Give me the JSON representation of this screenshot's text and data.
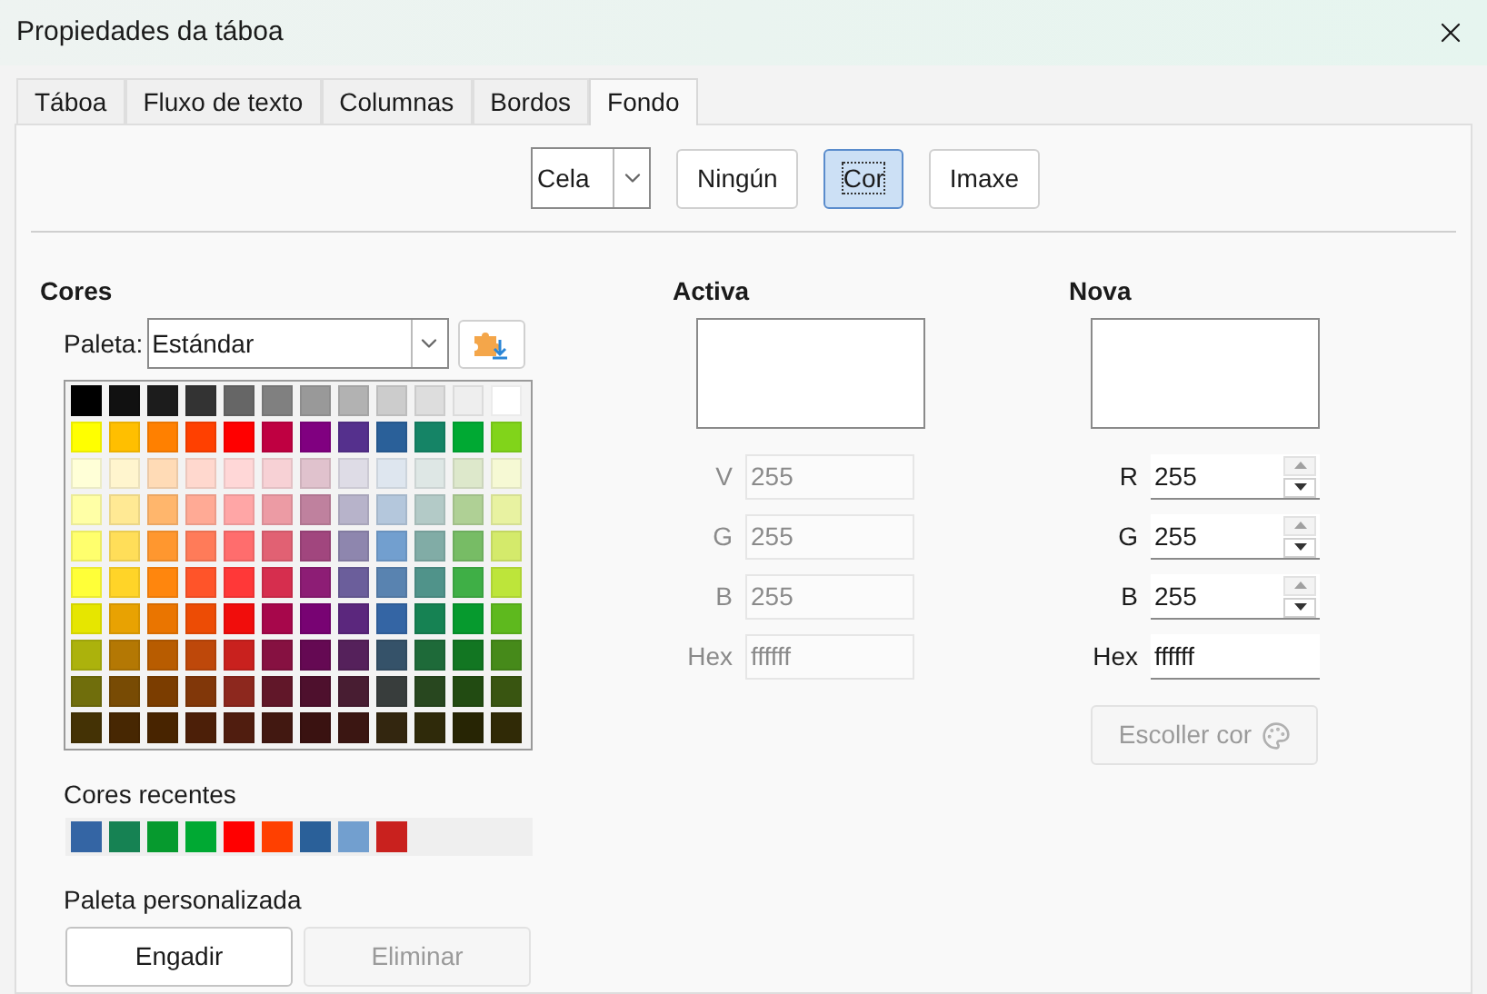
{
  "window": {
    "title": "Propiedades da táboa"
  },
  "tabs": [
    {
      "label": "Táboa",
      "selected": false
    },
    {
      "label": "Fluxo de texto",
      "selected": false
    },
    {
      "label": "Columnas",
      "selected": false
    },
    {
      "label": "Bordos",
      "selected": false
    },
    {
      "label": "Fondo",
      "selected": true
    }
  ],
  "fill_type": {
    "dropdown_value": "Cela",
    "buttons": [
      {
        "label": "Ningún",
        "selected": false
      },
      {
        "label": "Cor",
        "selected": true
      },
      {
        "label": "Imaxe",
        "selected": false
      }
    ]
  },
  "colors": {
    "heading": "Cores",
    "palette_label": "Paleta:",
    "palette_value": "Estándar",
    "swatches": [
      {
        "color": "#000000"
      },
      {
        "color": "#111111"
      },
      {
        "color": "#1c1c1c"
      },
      {
        "color": "#333333"
      },
      {
        "color": "#666666"
      },
      {
        "color": "#808080"
      },
      {
        "color": "#999999"
      },
      {
        "color": "#b2b2b2"
      },
      {
        "color": "#cccccc"
      },
      {
        "color": "#dddddd"
      },
      {
        "color": "#eeeeee"
      },
      {
        "color": "#ffffff"
      },
      {
        "color": "#ffff00"
      },
      {
        "color": "#ffbf00"
      },
      {
        "color": "#ff8000"
      },
      {
        "color": "#ff4000"
      },
      {
        "color": "#ff0000"
      },
      {
        "color": "#bf0041"
      },
      {
        "color": "#800080"
      },
      {
        "color": "#55308d"
      },
      {
        "color": "#2a6099"
      },
      {
        "color": "#158466"
      },
      {
        "color": "#00a933"
      },
      {
        "color": "#81d41a"
      },
      {
        "color": "#ffffd7"
      },
      {
        "color": "#fff5ce"
      },
      {
        "color": "#ffdbb6"
      },
      {
        "color": "#ffd8ce"
      },
      {
        "color": "#ffd7d7"
      },
      {
        "color": "#f7d1d5"
      },
      {
        "color": "#e0c2cd"
      },
      {
        "color": "#dedce6"
      },
      {
        "color": "#dee6ef"
      },
      {
        "color": "#dee7e5"
      },
      {
        "color": "#dde8cb"
      },
      {
        "color": "#f6f9d4"
      },
      {
        "color": "#ffffa6"
      },
      {
        "color": "#ffe994"
      },
      {
        "color": "#ffb66c"
      },
      {
        "color": "#ffaa95"
      },
      {
        "color": "#ffa6a6"
      },
      {
        "color": "#ec9ba4"
      },
      {
        "color": "#bf819e"
      },
      {
        "color": "#b7b3ca"
      },
      {
        "color": "#b4c7dc"
      },
      {
        "color": "#b3cac7"
      },
      {
        "color": "#afd095"
      },
      {
        "color": "#e8f2a1"
      },
      {
        "color": "#ffff6d"
      },
      {
        "color": "#ffde59"
      },
      {
        "color": "#ff972f"
      },
      {
        "color": "#ff7b59"
      },
      {
        "color": "#ff6d6d"
      },
      {
        "color": "#e16173"
      },
      {
        "color": "#a1467e"
      },
      {
        "color": "#8e86ae"
      },
      {
        "color": "#729fcf"
      },
      {
        "color": "#81aca6"
      },
      {
        "color": "#77bc65"
      },
      {
        "color": "#d4ea6b"
      },
      {
        "color": "#ffff38"
      },
      {
        "color": "#ffd428"
      },
      {
        "color": "#ff860d"
      },
      {
        "color": "#ff5429"
      },
      {
        "color": "#ff3838"
      },
      {
        "color": "#d62e4e"
      },
      {
        "color": "#8d1d75"
      },
      {
        "color": "#6b5e9b"
      },
      {
        "color": "#5983b0"
      },
      {
        "color": "#50938a"
      },
      {
        "color": "#3faf46"
      },
      {
        "color": "#bde53a"
      },
      {
        "color": "#e6e600"
      },
      {
        "color": "#e8a202"
      },
      {
        "color": "#ea7500"
      },
      {
        "color": "#ed4c05"
      },
      {
        "color": "#f10d0c"
      },
      {
        "color": "#a7074b"
      },
      {
        "color": "#780373"
      },
      {
        "color": "#5b277d"
      },
      {
        "color": "#3465a4"
      },
      {
        "color": "#168253"
      },
      {
        "color": "#069a2e"
      },
      {
        "color": "#5eb91e"
      },
      {
        "color": "#acb20c"
      },
      {
        "color": "#b47804"
      },
      {
        "color": "#b85c00"
      },
      {
        "color": "#be480a"
      },
      {
        "color": "#c9211e"
      },
      {
        "color": "#861141"
      },
      {
        "color": "#650953"
      },
      {
        "color": "#55215b"
      },
      {
        "color": "#355269"
      },
      {
        "color": "#1e6a39"
      },
      {
        "color": "#127622"
      },
      {
        "color": "#468a1a"
      },
      {
        "color": "#706e0c"
      },
      {
        "color": "#784b04"
      },
      {
        "color": "#7b3d00"
      },
      {
        "color": "#813709"
      },
      {
        "color": "#8d281e"
      },
      {
        "color": "#611729"
      },
      {
        "color": "#4e102d"
      },
      {
        "color": "#481d32"
      },
      {
        "color": "#383d3c"
      },
      {
        "color": "#28471f"
      },
      {
        "color": "#224b12"
      },
      {
        "color": "#395511"
      },
      {
        "color": "#443205"
      },
      {
        "color": "#472702"
      },
      {
        "color": "#482400"
      },
      {
        "color": "#4c1f08"
      },
      {
        "color": "#501d0f"
      },
      {
        "color": "#421811"
      },
      {
        "color": "#3a1211"
      },
      {
        "color": "#3b1612"
      },
      {
        "color": "#33260f"
      },
      {
        "color": "#2f2a0a"
      },
      {
        "color": "#272504"
      },
      {
        "color": "#302a06"
      }
    ],
    "recent_label": "Cores recentes",
    "recent": [
      {
        "color": "#3465a4"
      },
      {
        "color": "#168253"
      },
      {
        "color": "#069a2e"
      },
      {
        "color": "#00a933"
      },
      {
        "color": "#ff0000"
      },
      {
        "color": "#ff4000"
      },
      {
        "color": "#2a6099"
      },
      {
        "color": "#729fcf"
      },
      {
        "color": "#c9211e"
      }
    ],
    "custom_label": "Paleta personalizada",
    "custom_buttons": [
      {
        "label": "Engadir",
        "disabled": false
      },
      {
        "label": "Eliminar",
        "disabled": true
      }
    ]
  },
  "active": {
    "heading": "Activa",
    "fields": [
      {
        "label": "V",
        "value": "255",
        "disabled": true
      },
      {
        "label": "G",
        "value": "255",
        "disabled": true
      },
      {
        "label": "B",
        "value": "255",
        "disabled": true
      },
      {
        "label": "Hex",
        "value": "ffffff",
        "disabled": true
      }
    ]
  },
  "new": {
    "heading": "Nova",
    "fields": [
      {
        "label": "R",
        "value": "255",
        "kind": "spin"
      },
      {
        "label": "G",
        "value": "255",
        "kind": "spin"
      },
      {
        "label": "B",
        "value": "255",
        "kind": "spin"
      },
      {
        "label": "Hex",
        "value": "ffffff",
        "kind": "text"
      }
    ],
    "pick_button": {
      "label": "Escoller cor",
      "disabled": true
    }
  }
}
